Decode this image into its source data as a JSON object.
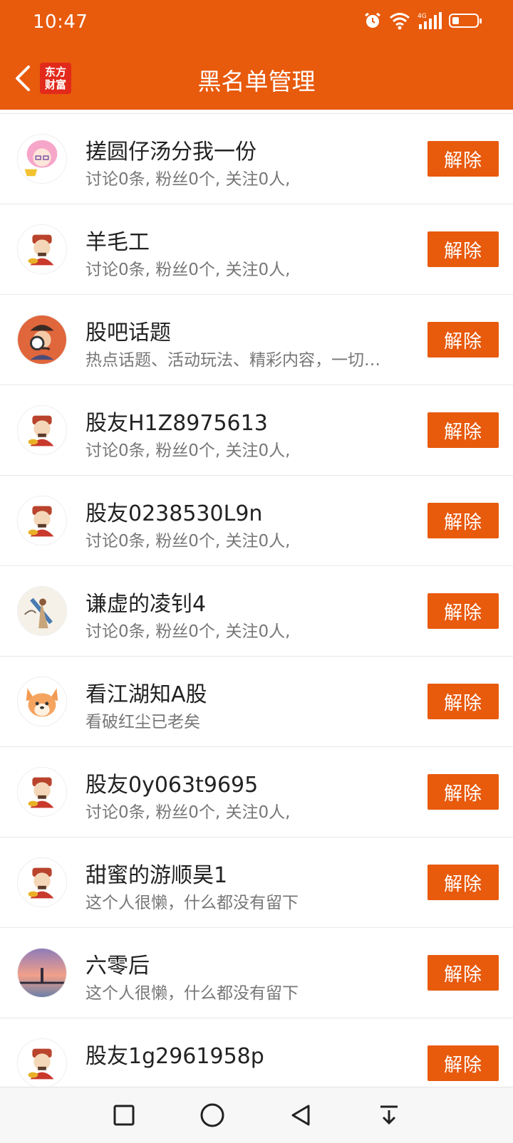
{
  "status_bar": {
    "time": "10:47",
    "network": "4G"
  },
  "header": {
    "title": "黑名单管理",
    "logo_line1": "东方",
    "logo_line2": "财富"
  },
  "colors": {
    "brand": "#E85A0C",
    "logo_bg": "#E22A1B"
  },
  "rows": [
    {
      "name": "搓圆仔汤分我一份",
      "desc": "讨论0条, 粉丝0个, 关注0人,",
      "button": "解除",
      "avatar": "anime-girl-avatar"
    },
    {
      "name": "羊毛工",
      "desc": "讨论0条, 粉丝0个, 关注0人,",
      "button": "解除",
      "avatar": "fortune-god-avatar"
    },
    {
      "name": "股吧话题",
      "desc": "热点话题、活动玩法、精彩内容，一切…",
      "button": "解除",
      "avatar": "detective-avatar"
    },
    {
      "name": "股友H1Z8975613",
      "desc": "讨论0条, 粉丝0个, 关注0人,",
      "button": "解除",
      "avatar": "fortune-god-avatar"
    },
    {
      "name": "股友0238530L9n",
      "desc": "讨论0条, 粉丝0个, 关注0人,",
      "button": "解除",
      "avatar": "fortune-god-avatar"
    },
    {
      "name": "谦虚的凌钊4",
      "desc": "讨论0条, 粉丝0个, 关注0人,",
      "button": "解除",
      "avatar": "painting-avatar"
    },
    {
      "name": "看江湖知A股",
      "desc": "看破红尘已老矣",
      "button": "解除",
      "avatar": "dog-avatar"
    },
    {
      "name": "股友0y063t9695",
      "desc": "讨论0条, 粉丝0个, 关注0人,",
      "button": "解除",
      "avatar": "fortune-god-avatar"
    },
    {
      "name": "甜蜜的游顺昊1",
      "desc": "这个人很懒，什么都没有留下",
      "button": "解除",
      "avatar": "fortune-god-avatar"
    },
    {
      "name": "六零后",
      "desc": "这个人很懒，什么都没有留下",
      "button": "解除",
      "avatar": "sunset-avatar"
    },
    {
      "name": "股友1g2961958p",
      "desc": "",
      "button": "解除",
      "avatar": "fortune-god-avatar"
    }
  ]
}
